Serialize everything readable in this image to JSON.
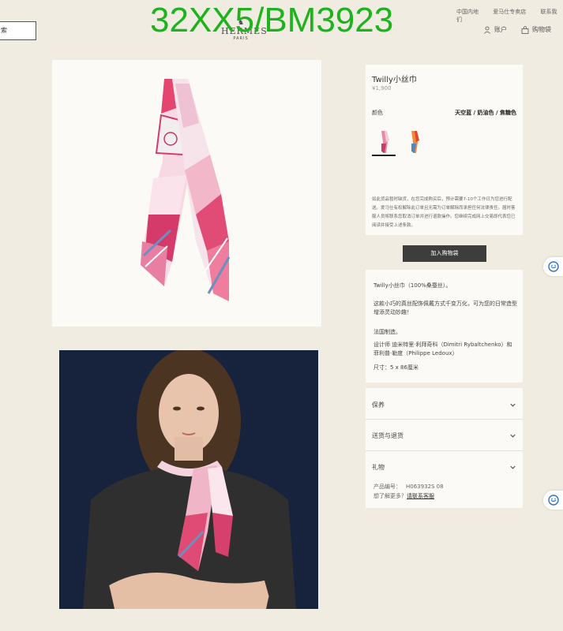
{
  "header": {
    "search_placeholder": "索",
    "watermark": "32XX5/BM3923",
    "brand_name": "HERMÈS",
    "brand_city": "PARIS",
    "top_links": [
      "中国内地",
      "爱马仕专卖店",
      "联系我们"
    ],
    "account_label": "账户",
    "bag_label": "购物袋"
  },
  "product": {
    "name": "Twilly小丝巾",
    "price": "¥1,900",
    "color_label": "颜色",
    "color_value": "天空蓝 / 奶油色 / 焦糖色",
    "notice": "如此货品暂时缺货，在您完成购买后，预计需要7-10个工作日为您进行配送。爱马仕有权解除此订单且无需为订单解除而承担任何法律责任。届时客服人员将联系您取消订单并进行退款操作。您继续完成网上交易即代表您已阅读并接受上述条款。",
    "add_to_cart": "加入购物袋",
    "description": {
      "line1": "Twilly小丝巾（100%桑蚕丝）。",
      "line2": "这款小巧的真丝配饰佩戴方式千变万化，可为您的日常造型增添灵动妙趣！",
      "line3": "法国制造。",
      "line4": "设计师 迪米特里·利拜奇科（Dimitri Rybaltchenko）和菲利普·勒度（Philippe Ledoux）",
      "line5": "尺寸：5 x 86厘米"
    }
  },
  "accordion": {
    "care": "保养",
    "delivery": "送货与退货",
    "gift": "礼物",
    "product_code_label": "产品编号：",
    "product_code": "H063932S 08",
    "contact_prefix": "想了解更多？",
    "contact_link": "请联系客服"
  },
  "colors": {
    "accent": "#3d3d3d",
    "background": "#f1ece2",
    "watermark": "#1db31d"
  }
}
